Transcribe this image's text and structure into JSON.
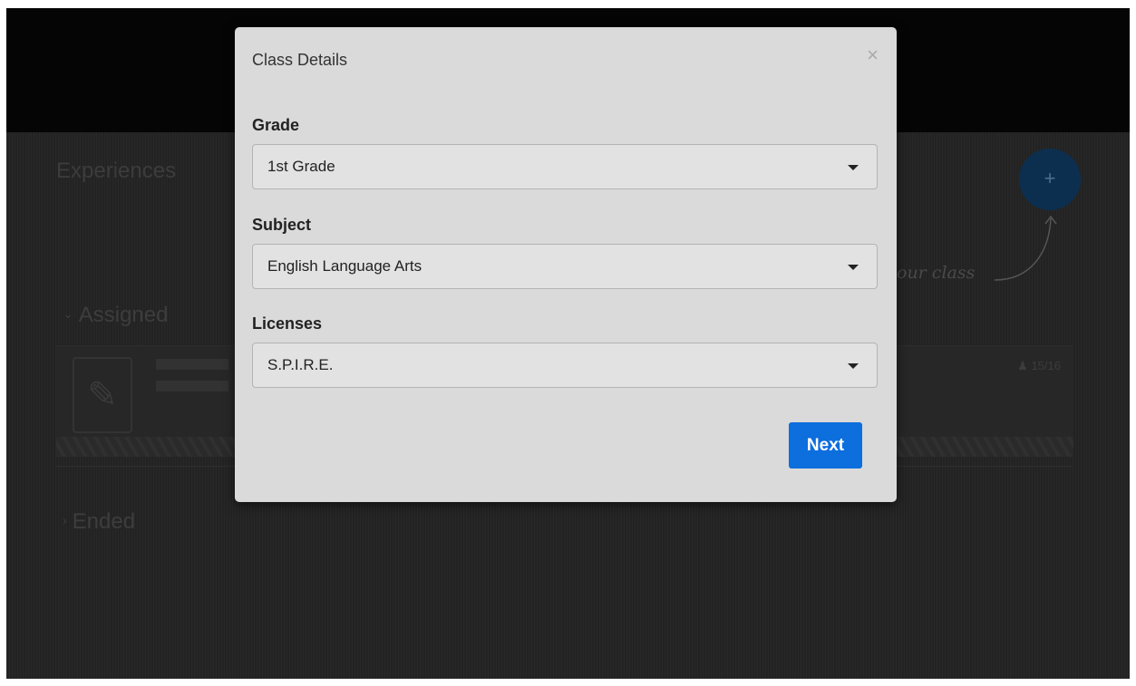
{
  "background": {
    "page_title": "Experiences",
    "add_button_label": "+",
    "hint_text": "our class",
    "sections": {
      "assigned": {
        "label": "Assigned",
        "chevron": "⌄"
      },
      "ended": {
        "label": "Ended",
        "chevron": "›"
      }
    },
    "card": {
      "student_count": "15/16"
    }
  },
  "modal": {
    "title": "Class Details",
    "close_glyph": "×",
    "fields": {
      "grade": {
        "label": "Grade",
        "value": "1st Grade"
      },
      "subject": {
        "label": "Subject",
        "value": "English Language Arts"
      },
      "licenses": {
        "label": "Licenses",
        "value": "S.P.I.R.E."
      }
    },
    "next_label": "Next"
  },
  "colors": {
    "primary_button": "#0d6ede",
    "modal_background": "#dadada",
    "overlay": "#232323",
    "fab": "#0c2f50"
  }
}
